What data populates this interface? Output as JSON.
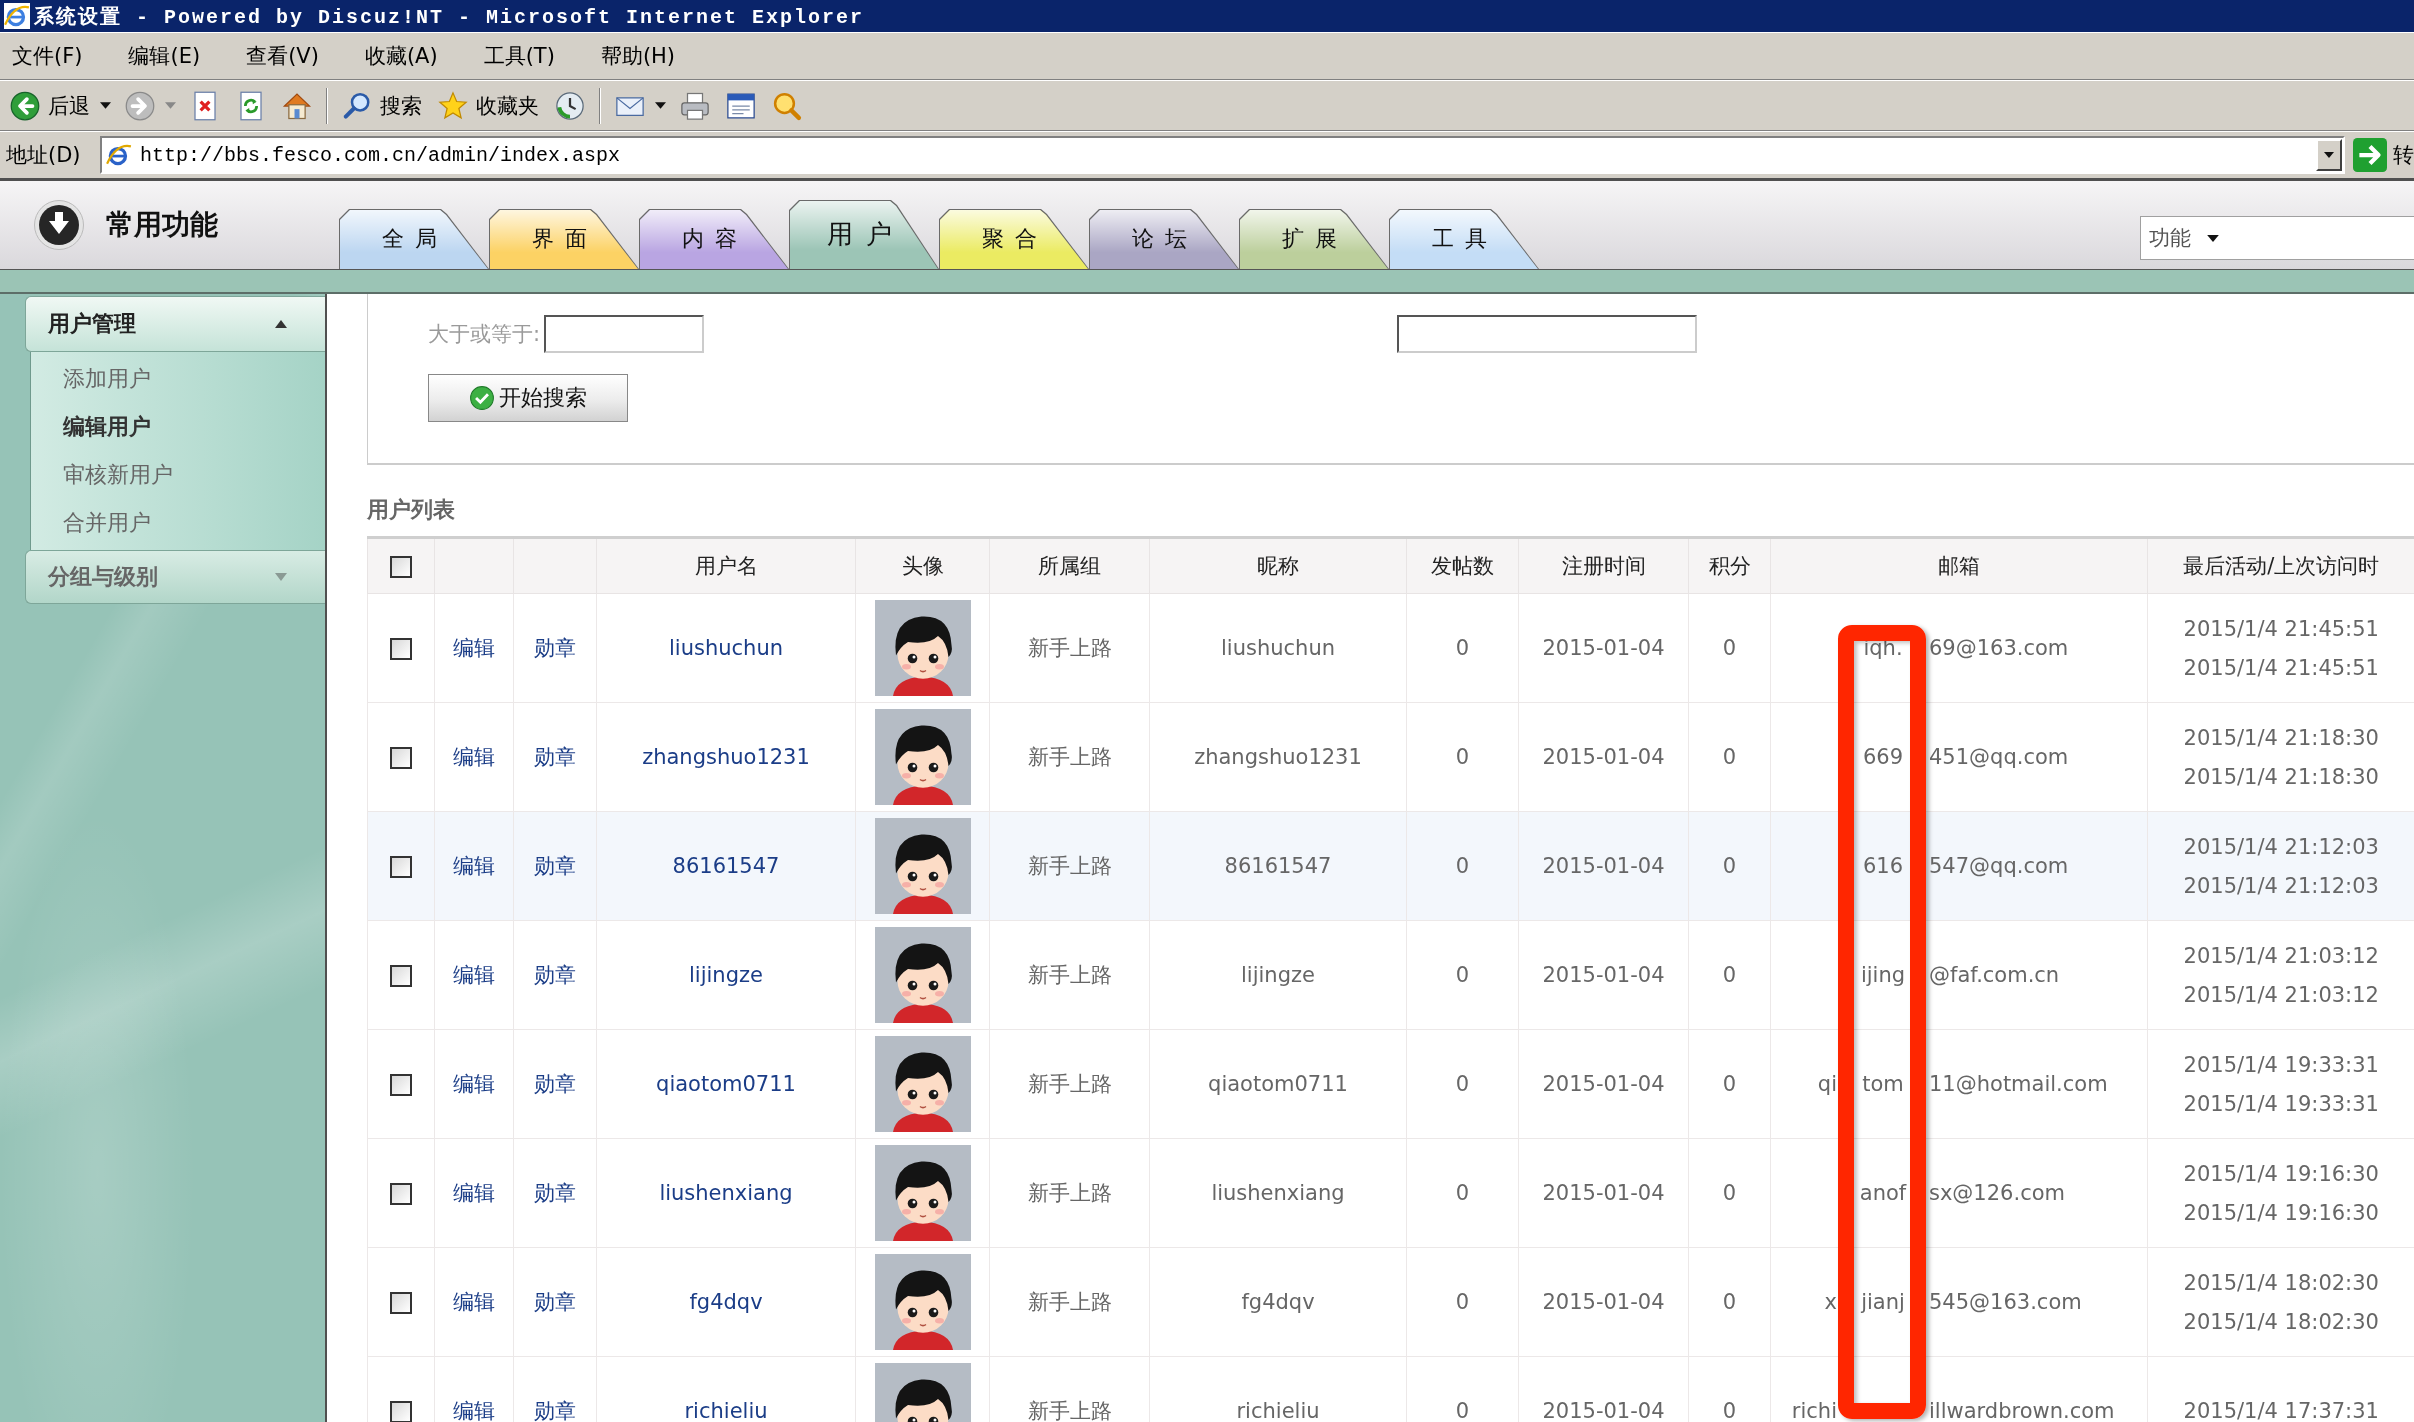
{
  "window": {
    "title": "系统设置 - Powered by Discuz!NT - Microsoft Internet Explorer"
  },
  "menu": [
    "文件(F)",
    "编辑(E)",
    "查看(V)",
    "收藏(A)",
    "工具(T)",
    "帮助(H)"
  ],
  "toolbar": [
    {
      "kind": "back",
      "label": "后退"
    },
    {
      "kind": "forward"
    },
    {
      "kind": "stop"
    },
    {
      "kind": "refresh"
    },
    {
      "kind": "home"
    },
    {
      "kind": "search",
      "label": "搜索"
    },
    {
      "kind": "favorites",
      "label": "收藏夹"
    },
    {
      "kind": "history"
    },
    {
      "kind": "mail"
    },
    {
      "kind": "print"
    },
    {
      "kind": "edit"
    },
    {
      "kind": "messenger"
    }
  ],
  "address_bar": {
    "label": "地址(D)",
    "url": "http://bbs.fesco.com.cn/admin/index.aspx",
    "go": "转"
  },
  "header": {
    "title": "常用功能",
    "tabs": [
      {
        "label": "全局",
        "selected": false,
        "color": "#bcd6f1"
      },
      {
        "label": "界面",
        "selected": false,
        "color": "#fcd264"
      },
      {
        "label": "内容",
        "selected": false,
        "color": "#b9a5e2"
      },
      {
        "label": "用户",
        "selected": true,
        "color": "#9cc5b6"
      },
      {
        "label": "聚合",
        "selected": false,
        "color": "#ebeb62"
      },
      {
        "label": "论坛",
        "selected": false,
        "color": "#aaa6c4"
      },
      {
        "label": "扩展",
        "selected": false,
        "color": "#bccf9c"
      },
      {
        "label": "工具",
        "selected": false,
        "color": "#c4ddf6"
      }
    ],
    "function_select": {
      "value": "功能"
    }
  },
  "sidebar": {
    "sections": [
      {
        "title": "用户管理",
        "expanded": true,
        "items": [
          {
            "label": "添加用户",
            "selected": false
          },
          {
            "label": "编辑用户",
            "selected": true
          },
          {
            "label": "审核新用户",
            "selected": false
          },
          {
            "label": "合并用户",
            "selected": false
          }
        ]
      },
      {
        "title": "分组与级别",
        "expanded": false
      }
    ]
  },
  "search": {
    "label": "大于或等于:",
    "button": "开始搜索"
  },
  "user_list": {
    "title": "用户列表",
    "select_all": {
      "checked": false
    },
    "columns": [
      "用户名",
      "头像",
      "所属组",
      "昵称",
      "发帖数",
      "注册时间",
      "积分",
      "邮箱",
      "最后活动/上次访问时"
    ],
    "rows": [
      {
        "checked": false,
        "highlighted": false,
        "edit": "编辑",
        "medal": "勋章",
        "username": "liushuchun",
        "group": "新手上路",
        "nickname": "liushuchun",
        "posts": "0",
        "registered": "2015-01-04",
        "points": "0",
        "email": {
          "middle": "iqh.",
          "right": "69@163.com"
        },
        "last_active": [
          "2015/1/4 21:45:51",
          "2015/1/4 21:45:51"
        ]
      },
      {
        "checked": false,
        "highlighted": false,
        "edit": "编辑",
        "medal": "勋章",
        "username": "zhangshuo1231",
        "group": "新手上路",
        "nickname": "zhangshuo1231",
        "posts": "0",
        "registered": "2015-01-04",
        "points": "0",
        "email": {
          "middle": "669",
          "right": "451@qq.com"
        },
        "last_active": [
          "2015/1/4 21:18:30",
          "2015/1/4 21:18:30"
        ]
      },
      {
        "checked": false,
        "highlighted": true,
        "edit": "编辑",
        "medal": "勋章",
        "username": "86161547",
        "group": "新手上路",
        "nickname": "86161547",
        "posts": "0",
        "registered": "2015-01-04",
        "points": "0",
        "email": {
          "middle": "616",
          "right": "547@qq.com"
        },
        "last_active": [
          "2015/1/4 21:12:03",
          "2015/1/4 21:12:03"
        ]
      },
      {
        "checked": false,
        "highlighted": false,
        "edit": "编辑",
        "medal": "勋章",
        "username": "lijingze",
        "group": "新手上路",
        "nickname": "lijingze",
        "posts": "0",
        "registered": "2015-01-04",
        "points": "0",
        "email": {
          "middle": "ijing",
          "right": "@faf.com.cn"
        },
        "last_active": [
          "2015/1/4 21:03:12",
          "2015/1/4 21:03:12"
        ]
      },
      {
        "checked": false,
        "highlighted": false,
        "edit": "编辑",
        "medal": "勋章",
        "username": "qiaotom0711",
        "group": "新手上路",
        "nickname": "qiaotom0711",
        "posts": "0",
        "registered": "2015-01-04",
        "points": "0",
        "email": {
          "left": "qi",
          "middle": "tom",
          "right": "11@hotmail.com"
        },
        "last_active": [
          "2015/1/4 19:33:31",
          "2015/1/4 19:33:31"
        ]
      },
      {
        "checked": false,
        "highlighted": false,
        "edit": "编辑",
        "medal": "勋章",
        "username": "liushenxiang",
        "group": "新手上路",
        "nickname": "liushenxiang",
        "posts": "0",
        "registered": "2015-01-04",
        "points": "0",
        "email": {
          "middle": "anof",
          "right": "sx@126.com"
        },
        "last_active": [
          "2015/1/4 19:16:30",
          "2015/1/4 19:16:30"
        ]
      },
      {
        "checked": false,
        "highlighted": false,
        "edit": "编辑",
        "medal": "勋章",
        "username": "fg4dqv",
        "group": "新手上路",
        "nickname": "fg4dqv",
        "posts": "0",
        "registered": "2015-01-04",
        "points": "0",
        "email": {
          "left": "x",
          "middle": "jianj",
          "right": "545@163.com"
        },
        "last_active": [
          "2015/1/4 18:02:30",
          "2015/1/4 18:02:30"
        ]
      },
      {
        "checked": false,
        "highlighted": false,
        "edit": "编辑",
        "medal": "勋章",
        "username": "richieliu",
        "group": "新手上路",
        "nickname": "richieliu",
        "posts": "0",
        "registered": "2015-01-04",
        "points": "0",
        "email": {
          "left": "richi",
          "right": "illwardbrown.com"
        },
        "last_active": [
          "2015/1/4 17:37:31"
        ]
      }
    ]
  }
}
